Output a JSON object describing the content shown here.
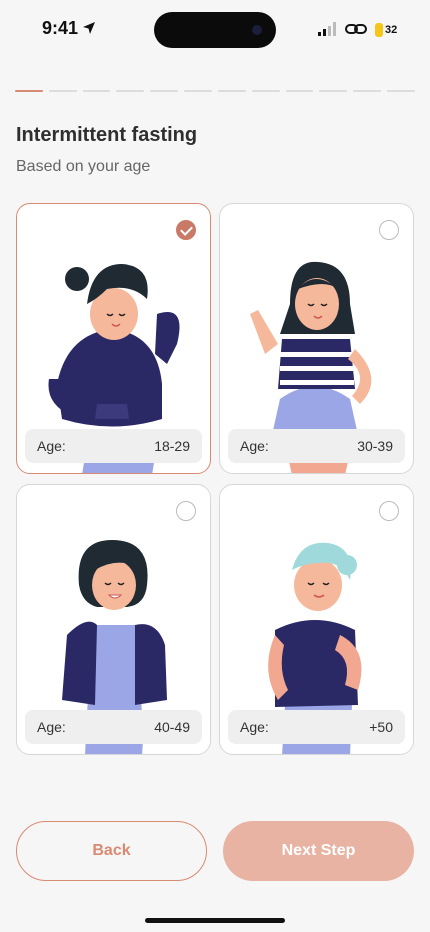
{
  "status_bar": {
    "time": "9:41",
    "battery": "32"
  },
  "progress": {
    "total_segments": 12,
    "active_segments": 1
  },
  "header": {
    "title": "Intermittent fasting",
    "subtitle": "Based on your age"
  },
  "options": [
    {
      "age_label": "Age:",
      "range": "18-29",
      "selected": true
    },
    {
      "age_label": "Age:",
      "range": "30-39",
      "selected": false
    },
    {
      "age_label": "Age:",
      "range": "40-49",
      "selected": false
    },
    {
      "age_label": "Age:",
      "range": "+50",
      "selected": false
    }
  ],
  "actions": {
    "back_label": "Back",
    "next_label": "Next Step"
  },
  "colors": {
    "accent": "#d98a72",
    "next_bg": "#e8b3a3",
    "navy": "#2b2866",
    "lavender": "#9aa6e6"
  }
}
